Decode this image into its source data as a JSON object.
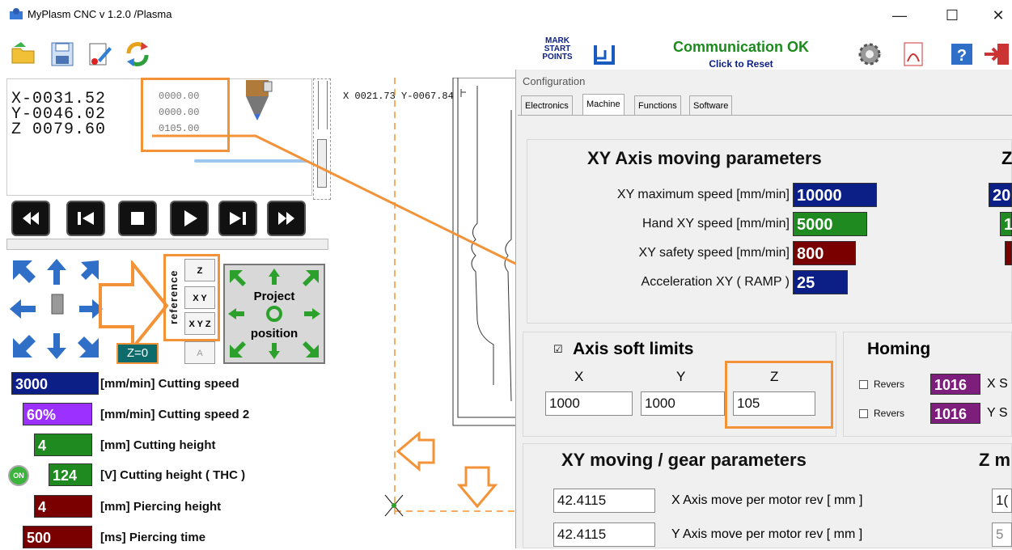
{
  "window": {
    "title": "MyPlasm CNC v 1.2.0  /Plasma",
    "minimize": "—",
    "maximize": "☐",
    "close": "✕"
  },
  "toolbar": {
    "mark_start_points": [
      "MARK",
      "START",
      "POINTS"
    ],
    "status_line1": "Communication OK",
    "status_line2": "Click to Reset"
  },
  "dro": {
    "x": "X-0031.52",
    "y": "Y-0046.02",
    "z": "Z 0079.60",
    "x_small": "0000.00",
    "y_small": "0000.00",
    "z_small": "0105.00"
  },
  "canvas": {
    "coords": "X 0021.73  Y-0067.84"
  },
  "reference": {
    "label": "reference",
    "z": "Z",
    "xy": "X Y",
    "xyz": "X Y Z",
    "a": "A",
    "project_line1": "Project",
    "project_line2": "position",
    "z_zero": "Z=0"
  },
  "params": [
    {
      "value": "3000",
      "label": "[mm/min] Cutting speed",
      "color": "#0b1f86"
    },
    {
      "value": "60%",
      "label": "[mm/min] Cutting speed 2",
      "color": "#9b30ff"
    },
    {
      "value": "4",
      "label": "[mm] Cutting height",
      "color": "#1f8a1f"
    },
    {
      "value": "124",
      "label": "[V] Cutting height ( THC )",
      "color": "#1f8a1f",
      "toggle": "ON"
    },
    {
      "value": "4",
      "label": "[mm] Piercing height",
      "color": "#7a0000"
    },
    {
      "value": "500",
      "label": "[ms] Piercing time",
      "color": "#7a0000"
    }
  ],
  "config": {
    "title": "Configuration",
    "tabs": [
      "Electronics",
      "Machine",
      "Functions",
      "Software"
    ],
    "active_tab": "Machine",
    "xy_section": {
      "title": "XY Axis moving parameters",
      "rows": [
        {
          "label": "XY maximum speed [mm/min]",
          "value": "10000",
          "color": "#0b1f86"
        },
        {
          "label": "Hand XY speed [mm/min]",
          "value": "5000",
          "color": "#1f8a1f"
        },
        {
          "label": "XY safety speed [mm/min]",
          "value": "800",
          "color": "#7a0000"
        },
        {
          "label": "Acceleration XY ( RAMP )",
          "value": "25",
          "color": "#0b1f86"
        }
      ],
      "right_partial": [
        "20",
        "1"
      ]
    },
    "soft_limits": {
      "title": "Axis soft limits",
      "check": "☑",
      "cols": [
        "X",
        "Y",
        "Z"
      ],
      "values": [
        "1000",
        "1000",
        "105"
      ]
    },
    "homing": {
      "title": "Homing",
      "revers": "Revers",
      "values": [
        "1016",
        "1016"
      ],
      "partial": [
        "X S",
        "Y S"
      ]
    },
    "gear": {
      "title": "XY moving / gear parameters",
      "right_title": "Z m",
      "rows": [
        {
          "value": "42.4115",
          "label": "X Axis move per motor rev [ mm ]",
          "right": "1("
        },
        {
          "value": "42.4115",
          "label": "Y Axis move per motor rev [ mm ]",
          "right": "5"
        }
      ]
    }
  }
}
